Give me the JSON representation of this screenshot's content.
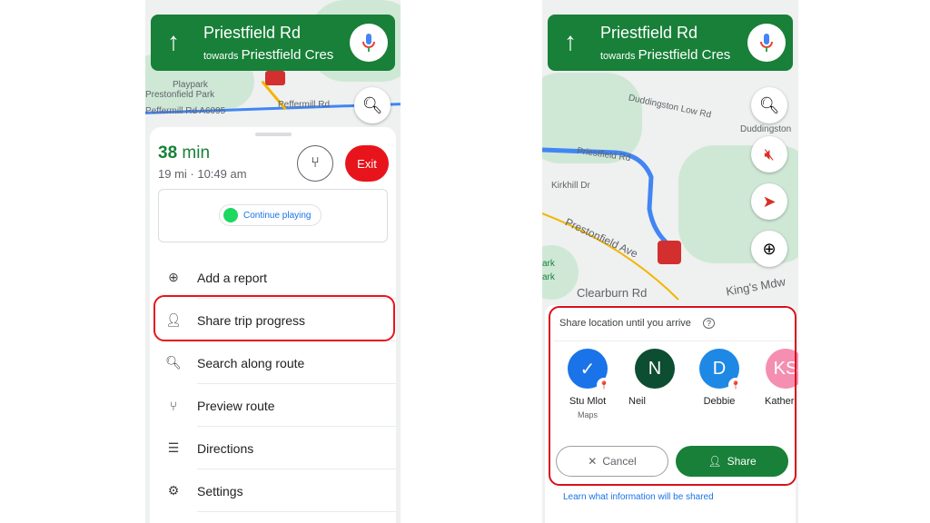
{
  "nav": {
    "street": "Priestfield Rd",
    "towards_prefix": "towards",
    "towards": "Priestfield Cres"
  },
  "left": {
    "map_labels": [
      "Playpark",
      "Prestonfield Park",
      "Peffermill Rd A6095",
      "Peffermill Rd"
    ],
    "eta": {
      "minutes": "38",
      "unit": "min",
      "detail": "19 mi · 10:49 am"
    },
    "exit_label": "Exit",
    "media": {
      "continue_label": "Continue playing"
    },
    "menu": [
      {
        "icon": "add-report-icon",
        "label": "Add a report"
      },
      {
        "icon": "share-trip-icon",
        "label": "Share trip progress"
      },
      {
        "icon": "search-icon",
        "label": "Search along route"
      },
      {
        "icon": "preview-route-icon",
        "label": "Preview route"
      },
      {
        "icon": "directions-list-icon",
        "label": "Directions"
      },
      {
        "icon": "gear-icon",
        "label": "Settings"
      }
    ]
  },
  "right": {
    "map_labels": [
      "Duddingston Low Rd",
      "Duddingston",
      "Priestfield Rd",
      "Kirkhill Dr",
      "Prestonfield Ave",
      "Clearburn Rd",
      "King's Mdw",
      "ark",
      "ark"
    ],
    "share": {
      "title": "Share location until you arrive",
      "contacts": [
        {
          "initial": "✓",
          "name": "Stu Mlot",
          "sub": "Maps",
          "color": "#1a73e8"
        },
        {
          "initial": "N",
          "name": "Neil",
          "sub": "",
          "color": "#0d4d32"
        },
        {
          "initial": "D",
          "name": "Debbie",
          "sub": "",
          "color": "#1e88e5"
        },
        {
          "initial": "KS",
          "name": "Kather",
          "sub": "",
          "color": "#f48fb1"
        }
      ],
      "cancel_label": "Cancel",
      "share_label": "Share",
      "learn_link": "Learn what information will be shared"
    }
  },
  "colors": {
    "nav_green": "#188038",
    "exit_red": "#e8141c",
    "highlight": "#e8141c",
    "route": "#4285f4"
  }
}
